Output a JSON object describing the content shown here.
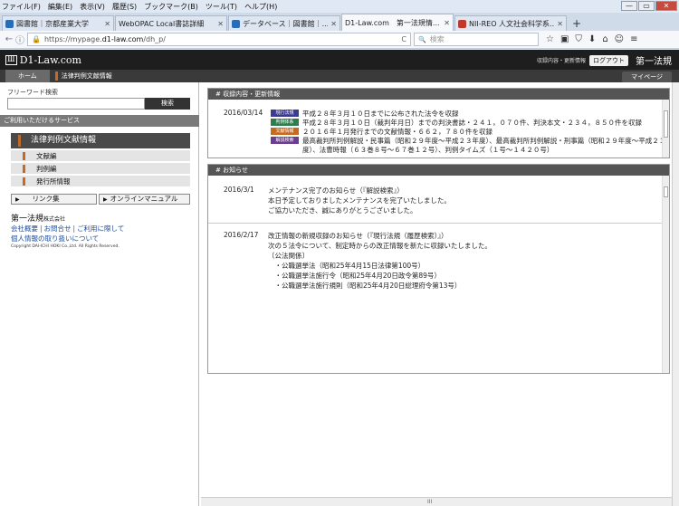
{
  "menu": [
    "ファイル(F)",
    "編集(E)",
    "表示(V)",
    "履歴(S)",
    "ブックマーク(B)",
    "ツール(T)",
    "ヘルプ(H)"
  ],
  "window_controls": {
    "min": "—",
    "max": "▭",
    "close": "✕"
  },
  "tabs": [
    {
      "label": "図書館｜京都産業大学",
      "active": false,
      "color": "#2a6db5"
    },
    {
      "label": "WebOPAC Local書誌詳細",
      "active": false,
      "color": "#8aa6c8"
    },
    {
      "label": "データベース｜図書館｜...",
      "active": false,
      "color": "#2a6db5"
    },
    {
      "label": "D1-Law.com　第一法規情...",
      "active": true,
      "color": "#ffffff"
    },
    {
      "label": "NII-REO 人文社会科学系...",
      "active": false,
      "color": "#c0392b"
    }
  ],
  "tab_close": "✕",
  "tab_new": "+",
  "nav": {
    "back": "←",
    "info": "ⓘ",
    "lock": "🔒",
    "url_prefix": "https://mypage.",
    "url_domain": "d1-law.com",
    "url_path": "/dh_p/",
    "reload": "C",
    "search_placeholder": "検索",
    "search_icon": "🔍",
    "icons": [
      "☆",
      "▣",
      "⛉",
      "⬇",
      "⌂",
      "☺",
      "≡"
    ]
  },
  "site": {
    "logo_mark": "Ⅲ",
    "logo_text": "D1-Law.com",
    "header_small": "収録内容・更新情報",
    "logout": "ログアウト",
    "brand": "第一法規",
    "home": "ホーム",
    "current_service": "法律判例文献情報",
    "mypage": "マイページ"
  },
  "sidebar": {
    "freeword_label": "フリーワード検索",
    "search_button": "検索",
    "services_bar": "ご利用いただけるサービス",
    "service_head": "法律判例文献情報",
    "items": [
      "文献編",
      "判例編",
      "発行所情報"
    ],
    "link_button": "リンク集",
    "manual_button": "オンラインマニュアル",
    "tri": "▶",
    "corp_name": "第一法規",
    "corp_suffix": "株式会社",
    "links_row1": [
      "会社概要",
      "お問合せ",
      "ご利用に際して"
    ],
    "link_sep": "|",
    "links_row2": "個人情報の取り扱いについて",
    "copyright": "Copyright DAI-ICHI HOKI Co.,Ltd. All Rights Reserved."
  },
  "updates": {
    "title": "収録内容・更新情報",
    "date": "2016/03/14",
    "rows": [
      {
        "badge": "現行法規",
        "color": "#3b3b8f",
        "lines": [
          "平成２８年３月１０日までに公布された法令を収録"
        ]
      },
      {
        "badge": "判例体系",
        "color": "#2e7d4f",
        "lines": [
          "平成２８年３月１０日（裁判年月日）までの判決書誌・２４１，０７０件、判決本文・２３４，８５０件を収録"
        ]
      },
      {
        "badge": "文献情報",
        "color": "#c86a1e",
        "lines": [
          "２０１６年１月発行までの文献情報・６６２，７８０件を収録"
        ]
      },
      {
        "badge": "解説検索",
        "color": "#6a3d8f",
        "lines": [
          "最高裁判所判例解説・民事篇（昭和２９年度〜平成２３年度）、最高裁判所判例解説・刑事篇（昭和２９年度〜平成２３年",
          "度）、法曹時報（６３巻８号〜６７巻１２号）、判例タイムズ（１号〜１４２０号）"
        ]
      }
    ]
  },
  "news": {
    "title": "お知らせ",
    "items": [
      {
        "date": "2016/3/1",
        "lines": [
          "メンテナンス完了のお知らせ（『解説検索』）",
          "本日予定しておりましたメンテナンスを完了いたしました。",
          "ご協力いただき、誠にありがとうございました。"
        ]
      },
      {
        "date": "2016/2/17",
        "lines": [
          "改正情報の新規収録のお知らせ（『現行法規（履歴検索）』）",
          "次の５法令について、制定時からの改正情報を新たに収録いたしました。",
          "〔公法関係〕",
          "　・公職選挙法（昭和25年4月15日法律第100号）",
          "　・公職選挙法施行令（昭和25年4月20日政令第89号）",
          "　・公職選挙法施行規則（昭和25年4月20日総理府令第13号）"
        ]
      }
    ]
  },
  "hscroll_mid": "III"
}
